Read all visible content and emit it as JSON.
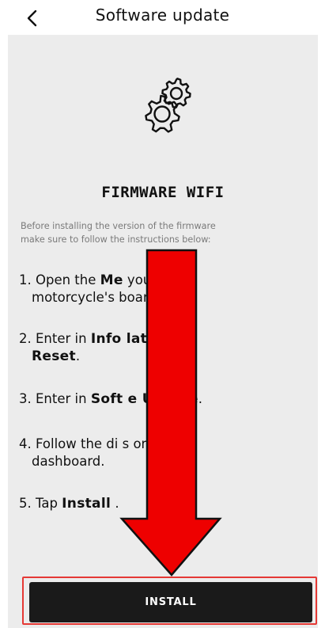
{
  "header": {
    "title": "Software update",
    "back_icon": "chevron-left-icon"
  },
  "hero": {
    "icon": "gears-icon",
    "title": "FIRMWARE WIFI"
  },
  "intro": {
    "line1": "Before installing the    version of the firmware",
    "line2": "make sure to follow the instructions below:"
  },
  "steps": [
    {
      "pre": "1. Open the ",
      "bold": "Me",
      "post": "           your",
      "cont": "motorcycle's          board."
    },
    {
      "pre": "2. Enter in ",
      "bold": "Info          late e",
      "cont_bold": "Reset",
      "cont_post": "."
    },
    {
      "pre": "3. Enter in ",
      "bold": "Soft        e Update",
      "post": "."
    },
    {
      "pre": "4. Follow the di          s on the",
      "cont": "dashboard."
    },
    {
      "pre": "5. Tap ",
      "bold": "Install",
      "post": "               ."
    }
  ],
  "overlay": {
    "arrow_icon": "red-arrow-down-icon",
    "arrow_color": "#ee0000",
    "highlight_color": "#e53935"
  },
  "footer": {
    "install_label": "INSTALL"
  },
  "colors": {
    "background": "#ececec",
    "button": "#1a1a1a",
    "text": "#111111",
    "muted": "#7a7a7a"
  }
}
